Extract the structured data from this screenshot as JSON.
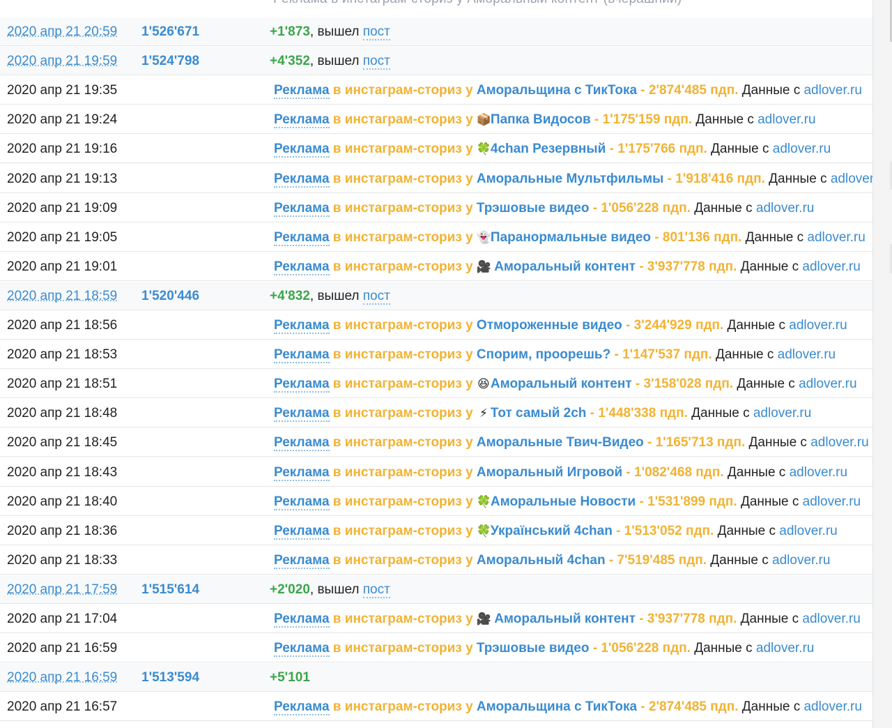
{
  "header_fragment": "Реклама в инстаграм-сториз у Аморальный контент (вчерашний)",
  "rows": [
    {
      "kind": "sub",
      "time": "2020 апр 21 20:59",
      "subs": "1'526'671",
      "delta": "+1'873",
      "sep": ", вышел ",
      "link": "пост"
    },
    {
      "kind": "sub",
      "time": "2020 апр 21 19:59",
      "subs": "1'524'798",
      "delta": "+4'352",
      "sep": ", вышел ",
      "link": "пост"
    },
    {
      "kind": "ad",
      "time": "2020 апр 21 19:35",
      "ad_word": "Реклама",
      "mid": " в инстаграм-сториз у ",
      "emoji": "",
      "channel": "Аморальщина с ТикТока",
      "stats": " - 2'874'485 пдп.",
      "data_prefix": " Данные с ",
      "source": "adlover.ru"
    },
    {
      "kind": "ad",
      "time": "2020 апр 21 19:24",
      "ad_word": "Реклама",
      "mid": " в инстаграм-сториз у ",
      "emoji": "📦",
      "channel": "Папка Видосов",
      "stats": " - 1'175'159 пдп.",
      "data_prefix": " Данные с ",
      "source": "adlover.ru"
    },
    {
      "kind": "ad",
      "time": "2020 апр 21 19:16",
      "ad_word": "Реклама",
      "mid": " в инстаграм-сториз у ",
      "emoji": "🍀",
      "channel": "4chan Резервный",
      "stats": " - 1'175'766 пдп.",
      "data_prefix": " Данные с ",
      "source": "adlover.ru"
    },
    {
      "kind": "ad",
      "time": "2020 апр 21 19:13",
      "ad_word": "Реклама",
      "mid": " в инстаграм-сториз у ",
      "emoji": "",
      "channel": "Аморальные Мультфильмы",
      "stats": " - 1'918'416 пдп.",
      "data_prefix": " Данные с ",
      "source": "adlover.ru"
    },
    {
      "kind": "ad",
      "time": "2020 апр 21 19:09",
      "ad_word": "Реклама",
      "mid": " в инстаграм-сториз у ",
      "emoji": "",
      "channel": "Трэшовые видео",
      "stats": " - 1'056'228 пдп.",
      "data_prefix": " Данные с ",
      "source": "adlover.ru"
    },
    {
      "kind": "ad",
      "time": "2020 апр 21 19:05",
      "ad_word": "Реклама",
      "mid": " в инстаграм-сториз у ",
      "emoji": "👻",
      "channel": "Паранормальные видео",
      "stats": " - 801'136 пдп.",
      "data_prefix": " Данные с ",
      "source": "adlover.ru"
    },
    {
      "kind": "ad",
      "time": "2020 апр 21 19:01",
      "ad_word": "Реклама",
      "mid": " в инстаграм-сториз у ",
      "emoji": "🎥",
      "channel": " Аморальный контент",
      "stats": " - 3'937'778 пдп.",
      "data_prefix": " Данные с ",
      "source": "adlover.ru"
    },
    {
      "kind": "sub",
      "time": "2020 апр 21 18:59",
      "subs": "1'520'446",
      "delta": "+4'832",
      "sep": ", вышел ",
      "link": "пост"
    },
    {
      "kind": "ad",
      "time": "2020 апр 21 18:56",
      "ad_word": "Реклама",
      "mid": " в инстаграм-сториз у ",
      "emoji": "",
      "channel": "Отмороженные видео",
      "stats": " - 3'244'929 пдп.",
      "data_prefix": " Данные с ",
      "source": "adlover.ru"
    },
    {
      "kind": "ad",
      "time": "2020 апр 21 18:53",
      "ad_word": "Реклама",
      "mid": " в инстаграм-сториз у ",
      "emoji": "",
      "channel": "Спорим, проорешь?",
      "stats": " - 1'147'537 пдп.",
      "data_prefix": " Данные с ",
      "source": "adlover.ru"
    },
    {
      "kind": "ad",
      "time": "2020 апр 21 18:51",
      "ad_word": "Реклама",
      "mid": " в инстаграм-сториз у ",
      "emoji": "😆",
      "channel": "Аморальный контент",
      "stats": " - 3'158'028 пдп.",
      "data_prefix": " Данные с ",
      "source": "adlover.ru"
    },
    {
      "kind": "ad",
      "time": "2020 апр 21 18:48",
      "ad_word": "Реклама",
      "mid": " в инстаграм-сториз у ",
      "emoji": "⚡",
      "channel": "Тот самый 2ch",
      "stats": " - 1'448'338 пдп.",
      "data_prefix": " Данные с ",
      "source": "adlover.ru"
    },
    {
      "kind": "ad",
      "time": "2020 апр 21 18:45",
      "ad_word": "Реклама",
      "mid": " в инстаграм-сториз у ",
      "emoji": "",
      "channel": "Аморальные Твич-Видео",
      "stats": " - 1'165'713 пдп.",
      "data_prefix": " Данные с ",
      "source": "adlover.ru"
    },
    {
      "kind": "ad",
      "time": "2020 апр 21 18:43",
      "ad_word": "Реклама",
      "mid": " в инстаграм-сториз у ",
      "emoji": "",
      "channel": "Аморальный Игровой",
      "stats": " - 1'082'468 пдп.",
      "data_prefix": " Данные с ",
      "source": "adlover.ru"
    },
    {
      "kind": "ad",
      "time": "2020 апр 21 18:40",
      "ad_word": "Реклама",
      "mid": " в инстаграм-сториз у ",
      "emoji": "🍀",
      "channel": "Аморальные Новости",
      "stats": " - 1'531'899 пдп.",
      "data_prefix": " Данные с ",
      "source": "adlover.ru"
    },
    {
      "kind": "ad",
      "time": "2020 апр 21 18:36",
      "ad_word": "Реклама",
      "mid": " в инстаграм-сториз у ",
      "emoji": "🍀",
      "channel": "Український 4chan",
      "stats": " - 1'513'052 пдп.",
      "data_prefix": " Данные с ",
      "source": "adlover.ru"
    },
    {
      "kind": "ad",
      "time": "2020 апр 21 18:33",
      "ad_word": "Реклама",
      "mid": " в инстаграм-сториз у ",
      "emoji": "",
      "channel": "Аморальный 4chan",
      "stats": " - 7'519'485 пдп.",
      "data_prefix": " Данные с ",
      "source": "adlover.ru"
    },
    {
      "kind": "sub",
      "time": "2020 апр 21 17:59",
      "subs": "1'515'614",
      "delta": "+2'020",
      "sep": ", вышел ",
      "link": "пост"
    },
    {
      "kind": "ad",
      "time": "2020 апр 21 17:04",
      "ad_word": "Реклама",
      "mid": " в инстаграм-сториз у ",
      "emoji": "🎥",
      "channel": " Аморальный контент",
      "stats": " - 3'937'778 пдп.",
      "data_prefix": " Данные с ",
      "source": "adlover.ru"
    },
    {
      "kind": "ad",
      "time": "2020 апр 21 16:59",
      "ad_word": "Реклама",
      "mid": " в инстаграм-сториз у ",
      "emoji": "",
      "channel": "Трэшовые видео",
      "stats": " - 1'056'228 пдп.",
      "data_prefix": " Данные с ",
      "source": "adlover.ru"
    },
    {
      "kind": "sub",
      "time": "2020 апр 21 16:59",
      "subs": "1'513'594",
      "delta": "+5'101",
      "sep": "",
      "link": ""
    },
    {
      "kind": "ad",
      "time": "2020 апр 21 16:57",
      "ad_word": "Реклама",
      "mid": " в инстаграм-сториз у ",
      "emoji": "",
      "channel": "Аморальщина с ТикТока",
      "stats": " - 2'874'485 пдп.",
      "data_prefix": " Данные с ",
      "source": "adlover.ru"
    }
  ]
}
